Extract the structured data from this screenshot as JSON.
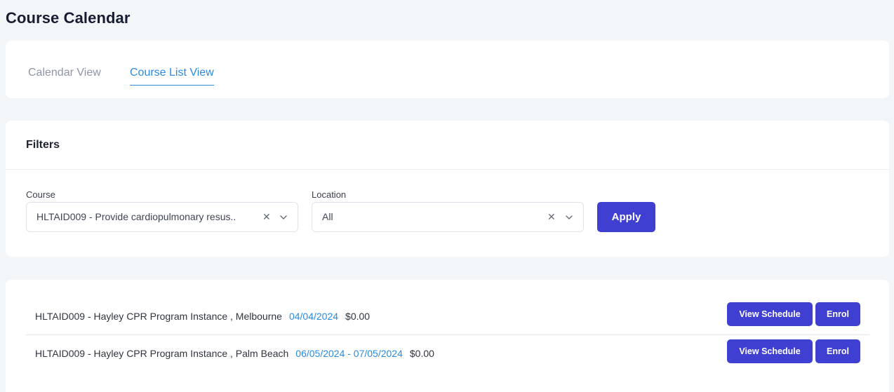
{
  "page": {
    "title": "Course Calendar"
  },
  "tabs": [
    {
      "label": "Calendar View",
      "active": false
    },
    {
      "label": "Course List View",
      "active": true
    }
  ],
  "filters": {
    "title": "Filters",
    "course": {
      "label": "Course",
      "value": "HLTAID009 - Provide cardiopulmonary resus..",
      "clear_icon": "close-icon",
      "toggle_icon": "chevron-down-icon"
    },
    "location": {
      "label": "Location",
      "value": "All",
      "clear_icon": "close-icon",
      "toggle_icon": "chevron-down-icon"
    },
    "apply_label": "Apply"
  },
  "courses": [
    {
      "name": "HLTAID009 - Hayley CPR Program Instance , Melbourne",
      "date": "04/04/2024",
      "price": "$0.00",
      "view_label": "View Schedule",
      "enrol_label": "Enrol"
    },
    {
      "name": "HLTAID009 - Hayley CPR Program Instance , Palm Beach",
      "date": "06/05/2024 - 07/05/2024",
      "price": "$0.00",
      "view_label": "View Schedule",
      "enrol_label": "Enrol"
    }
  ],
  "colors": {
    "accent": "#3f3fd1",
    "link": "#2b8be0",
    "background": "#f3f6f9"
  }
}
